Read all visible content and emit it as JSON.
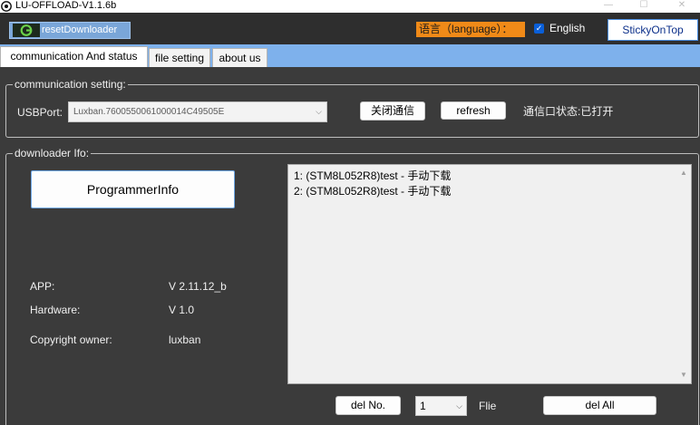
{
  "window": {
    "title": "LU-OFFLOAD-V1.1.6b",
    "icon": "app-logo-icon",
    "controls": {
      "minimize": "—",
      "maximize": "☐",
      "close": "✕"
    }
  },
  "toolbar": {
    "reset_button": "resetDownloader",
    "language_label": "语言（language）：",
    "english_checked": true,
    "english_check_glyph": "✓",
    "english_label": "English",
    "sticky_button": "StickyOnTop",
    "language_color": "#f08a18"
  },
  "tabs": [
    {
      "label": "communication And status",
      "active": true
    },
    {
      "label": "file setting",
      "active": false
    },
    {
      "label": "about us",
      "active": false
    }
  ],
  "communication": {
    "legend": "communication setting:",
    "usb_label": "USBPort:",
    "usb_value": "Luxban.7600550061000014C49505E",
    "close_button": "关闭通信",
    "refresh_button": "refresh",
    "port_status": "通信口状态:已打开"
  },
  "downloader": {
    "legend": "downloader Ifo:",
    "programmer_button": "ProgrammerInfo",
    "app_label": "APP:",
    "app_value": "V 2.11.12_b",
    "hardware_label": "Hardware:",
    "hardware_value": "V 1.0",
    "copyright_label": "Copyright owner:",
    "copyright_value": "luxban",
    "log": [
      "1: (STM8L052R8)test - 手动下载",
      "2: (STM8L052R8)test - 手动下载"
    ],
    "del_no_button": "del No.",
    "number_value": "1",
    "file_label": "Flie",
    "del_all_button": "del All"
  },
  "icons": {
    "combo_arrow": "⌵",
    "scroll_up": "▲",
    "scroll_down": "▼"
  }
}
